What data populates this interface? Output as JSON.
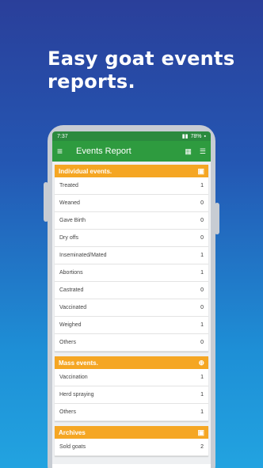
{
  "headline": {
    "line1": "Easy goat events",
    "line2": "reports."
  },
  "status": {
    "time": "7:37",
    "battery": "78%"
  },
  "appbar": {
    "title": "Events Report",
    "menu_icon": "hamburger-icon",
    "report_icon": "report-icon",
    "filter_icon": "filter-icon"
  },
  "individual": {
    "title": "Individual events.",
    "items": [
      {
        "label": "Treated",
        "value": "1"
      },
      {
        "label": "Weaned",
        "value": "0"
      },
      {
        "label": "Gave Birth",
        "value": "0"
      },
      {
        "label": "Dry offs",
        "value": "0"
      },
      {
        "label": "Inseminated/Mated",
        "value": "1"
      },
      {
        "label": "Abortions",
        "value": "1"
      },
      {
        "label": "Castrated",
        "value": "0"
      },
      {
        "label": "Vaccinated",
        "value": "0"
      },
      {
        "label": "Weighed",
        "value": "1"
      },
      {
        "label": "Others",
        "value": "0"
      }
    ]
  },
  "mass": {
    "title": "Mass events.",
    "items": [
      {
        "label": "Vaccination",
        "value": "1"
      },
      {
        "label": "Herd spraying",
        "value": "1"
      },
      {
        "label": "Others",
        "value": "1"
      }
    ]
  },
  "archives": {
    "title": "Archives",
    "items": [
      {
        "label": "Sold goats",
        "value": "2"
      }
    ]
  }
}
